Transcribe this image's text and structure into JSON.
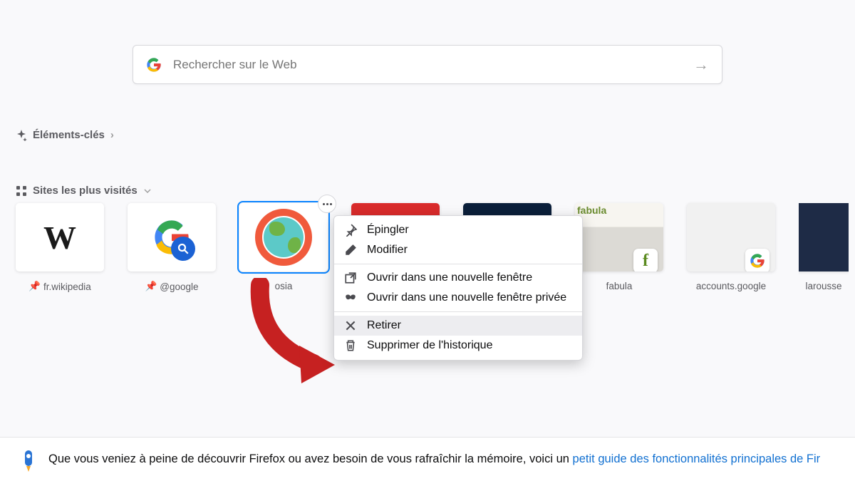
{
  "search": {
    "placeholder": "Rechercher sur le Web"
  },
  "sections": {
    "elements": "Éléments-clés",
    "top_sites": "Sites les plus visités"
  },
  "tiles": [
    {
      "label": "fr.wikipedia",
      "pinned": true
    },
    {
      "label": "@google",
      "pinned": true
    },
    {
      "label": "osia",
      "pinned": false
    },
    {
      "label": "fabula",
      "pinned": false
    },
    {
      "label": "accounts.google",
      "pinned": false
    },
    {
      "label": "larousse",
      "pinned": false
    }
  ],
  "context_menu": {
    "pin": "Épingler",
    "edit": "Modifier",
    "new_window": "Ouvrir dans une nouvelle fenêtre",
    "private_window": "Ouvrir dans une nouvelle fenêtre privée",
    "remove": "Retirer",
    "delete_history": "Supprimer de l'historique"
  },
  "footer": {
    "text": "Que vous veniez à peine de découvrir Firefox ou avez besoin de vous rafraîchir la mémoire, voici un ",
    "link": "petit guide des fonctionnalités principales de Fir"
  }
}
